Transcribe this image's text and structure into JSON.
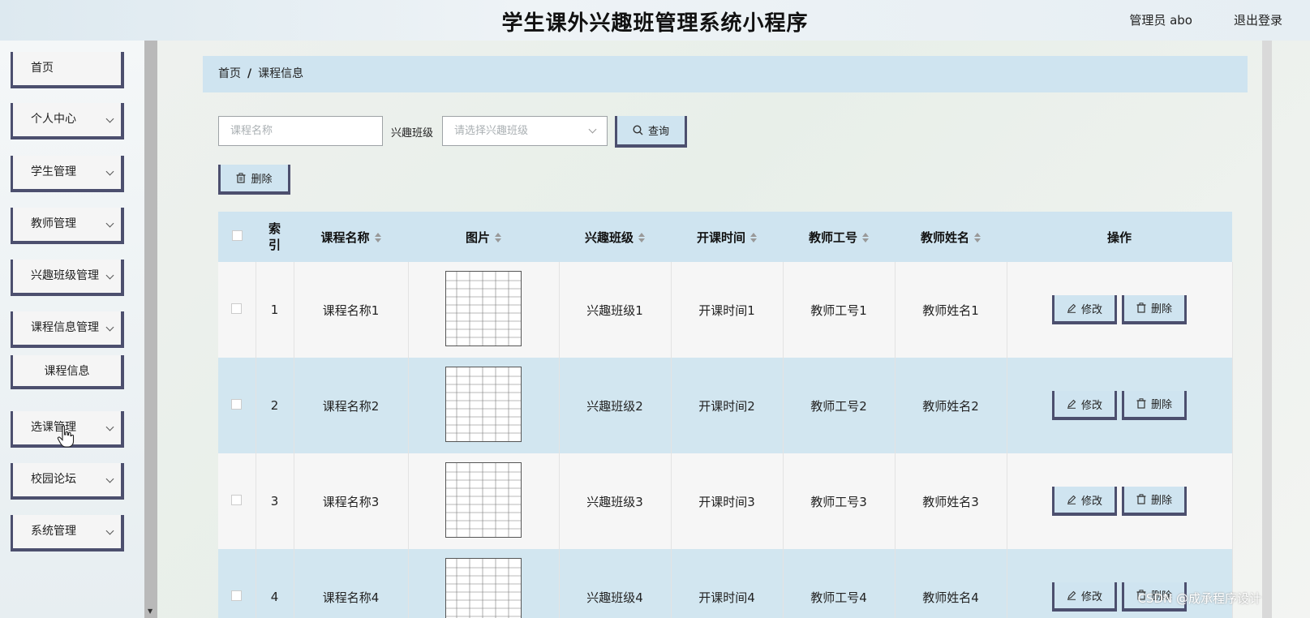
{
  "header": {
    "title": "学生课外兴趣班管理系统小程序",
    "user": "管理员 abo",
    "logout": "退出登录"
  },
  "sidebar": {
    "items": [
      {
        "label": "首页"
      },
      {
        "label": "个人中心"
      },
      {
        "label": "学生管理"
      },
      {
        "label": "教师管理"
      },
      {
        "label": "兴趣班级管理"
      },
      {
        "label": "课程信息管理"
      },
      {
        "label": "课程信息"
      },
      {
        "label": "选课管理"
      },
      {
        "label": "校园论坛"
      },
      {
        "label": "系统管理"
      }
    ]
  },
  "breadcrumb": {
    "home": "首页",
    "separator": "/",
    "current": "课程信息"
  },
  "search": {
    "placeholder": "课程名称",
    "filter_label": "兴趣班级",
    "select_placeholder": "请选择兴趣班级",
    "query_button": "查询"
  },
  "toolbar": {
    "delete_button": "删除"
  },
  "table": {
    "headers": {
      "index": "索引",
      "course_name": "课程名称",
      "image": "图片",
      "class": "兴趣班级",
      "start_time": "开课时间",
      "teacher_id": "教师工号",
      "teacher_name": "教师姓名",
      "actions": "操作"
    },
    "rows": [
      {
        "index": "1",
        "course_name": "课程名称1",
        "class": "兴趣班级1",
        "start_time": "开课时间1",
        "teacher_id": "教师工号1",
        "teacher_name": "教师姓名1"
      },
      {
        "index": "2",
        "course_name": "课程名称2",
        "class": "兴趣班级2",
        "start_time": "开课时间2",
        "teacher_id": "教师工号2",
        "teacher_name": "教师姓名2"
      },
      {
        "index": "3",
        "course_name": "课程名称3",
        "class": "兴趣班级3",
        "start_time": "开课时间3",
        "teacher_id": "教师工号3",
        "teacher_name": "教师姓名3"
      },
      {
        "index": "4",
        "course_name": "课程名称4",
        "class": "兴趣班级4",
        "start_time": "开课时间4",
        "teacher_id": "教师工号4",
        "teacher_name": "教师姓名4"
      }
    ],
    "edit_label": "修改",
    "delete_label": "删除"
  },
  "watermark": "CSDN @成承程序设计",
  "colors": {
    "accent": "#4c4f6e",
    "header_bg": "#cfe4f0",
    "row_alt": "#d2e6f0"
  }
}
